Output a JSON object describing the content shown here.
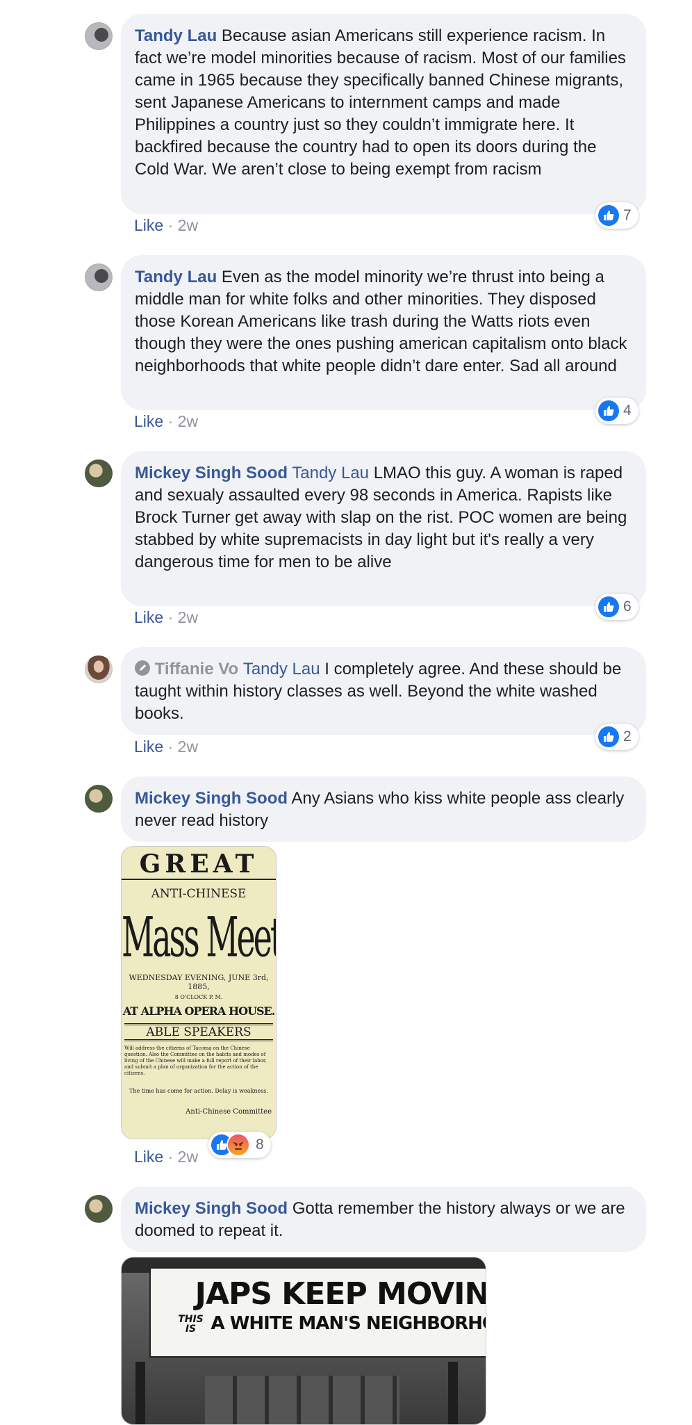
{
  "ui": {
    "like_label": "Like",
    "dot": "·"
  },
  "colors": {
    "link": "#385898",
    "bubble": "#f0f2f5",
    "like_blue": "#1877f2",
    "meta_gray": "#90949c"
  },
  "comments": [
    {
      "author": "Tandy Lau",
      "text": "Because asian Americans still experience racism. In fact we’re model minorities because of racism. Most of our families came in 1965 because they specifically banned Chinese migrants, sent Japanese Americans to internment camps and made Philippines a country just so they couldn’t immigrate here. It backfired because the country had to open its doors during the Cold War. We aren’t close to being exempt from racism",
      "time": "2w",
      "reactions": "7"
    },
    {
      "author": "Tandy Lau",
      "text": "Even as the model minority we’re thrust into being a middle man for white folks and other minorities. They disposed those Korean Americans like trash during the Watts riots even though they were the ones pushing american capitalism onto black neighborhoods that white people didn’t dare enter. Sad all around",
      "time": "2w",
      "reactions": "4"
    },
    {
      "author": "Mickey Singh Sood",
      "tag": "Tandy Lau",
      "text": "LMAO this guy. A woman is raped and sexualy assaulted every 98 seconds in America. Rapists like Brock Turner get away with slap on the rist. POC women are being stabbed by white supremacists in day light but it's really a very dangerous time for men to be alive",
      "time": "2w",
      "reactions": "6"
    },
    {
      "author": "Tiffanie Vo",
      "tag": "Tandy Lau",
      "text": "I completely agree. And these should be taught within history classes as well. Beyond the white washed books.",
      "time": "2w",
      "reactions": "2"
    },
    {
      "author": "Mickey Singh Sood",
      "text": "Any Asians who kiss white people ass clearly never read history",
      "time": "2w",
      "reactions": "8",
      "poster": {
        "line1": "GREAT",
        "line2": "ANTI-CHINESE",
        "line3": "Mass Meeting!",
        "line4": "WEDNESDAY EVENING, JUNE 3rd, 1885,",
        "line5": "8 O'CLOCK P. M.",
        "line6": "AT ALPHA OPERA HOUSE.",
        "line7": "ABLE SPEAKERS",
        "line8": "Will address the citizens of Tacoma on the Chinese question. Also the Committee on the habits and modes of living of the Chinese will make a full report of their labor, and submit a plan of organization for the action of the citizens.",
        "line9": "The time has come for action. Delay is weakness.",
        "line10": "Anti-Chinese Committee"
      }
    },
    {
      "author": "Mickey Singh Sood",
      "text": "Gotta remember the history always or we are doomed to repeat it.",
      "sign": {
        "line1": "JAPS KEEP MOVING",
        "line2a": "THIS IS",
        "line2b": "A WHITE MAN'S NEIGHBORHOOD."
      }
    }
  ]
}
